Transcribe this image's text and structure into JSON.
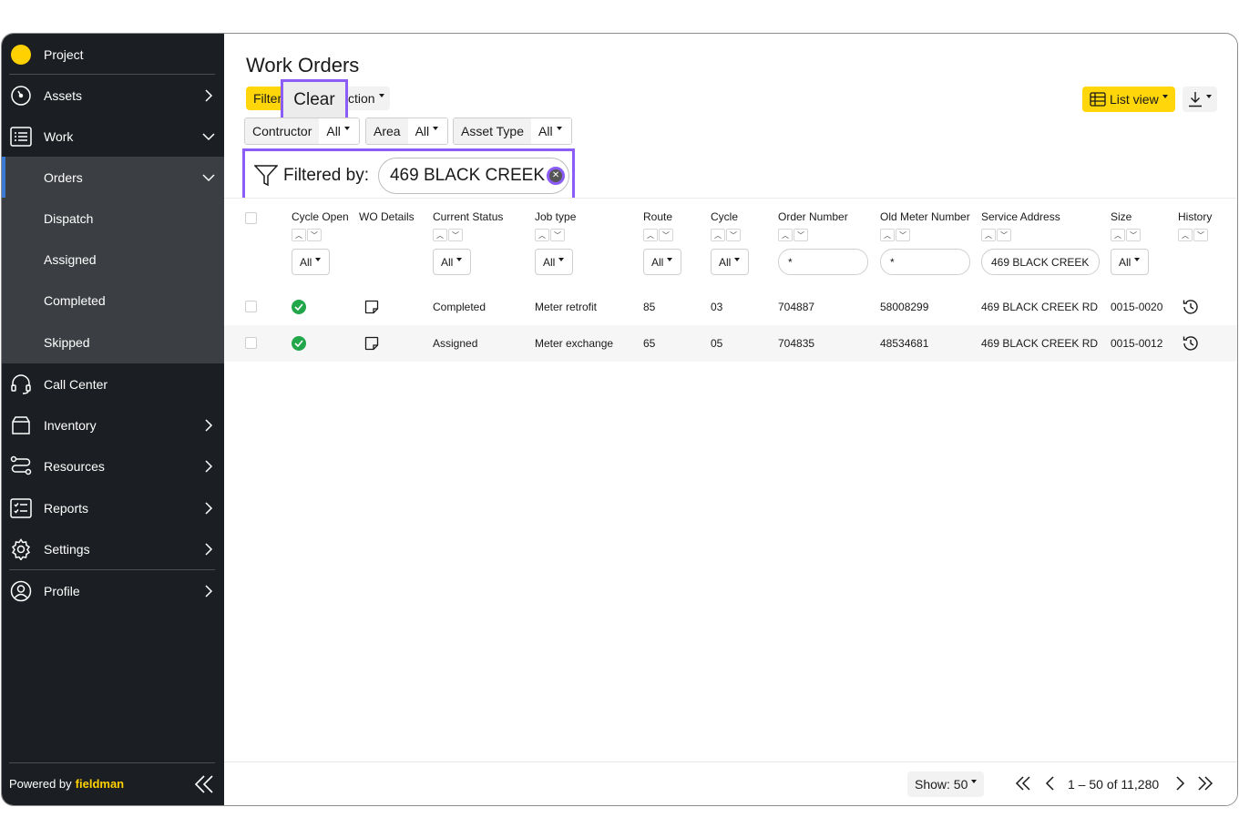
{
  "sidebar": {
    "items": [
      {
        "label": "Project",
        "icon": "project-dot"
      },
      {
        "label": "Assets",
        "icon": "gauge-icon"
      },
      {
        "label": "Work",
        "icon": "list-icon"
      },
      {
        "label": "Orders"
      },
      {
        "label": "Dispatch"
      },
      {
        "label": "Assigned"
      },
      {
        "label": "Completed"
      },
      {
        "label": "Skipped"
      },
      {
        "label": "Call Center",
        "icon": "headset-icon"
      },
      {
        "label": "Inventory",
        "icon": "box-icon"
      },
      {
        "label": "Resources",
        "icon": "route-icon"
      },
      {
        "label": "Reports",
        "icon": "report-icon"
      },
      {
        "label": "Settings",
        "icon": "gear-icon"
      },
      {
        "label": "Profile",
        "icon": "user-icon"
      }
    ],
    "powered_by": "Powered by",
    "brand": "fieldman"
  },
  "header": {
    "title": "Work Orders",
    "filter_label": "Filter",
    "clear_label": "Clear",
    "action_label": "ction",
    "view_label": "List view"
  },
  "filters": {
    "contractor_key": "Contructor",
    "contractor_val": "All",
    "area_key": "Area",
    "area_val": "All",
    "asset_type_key": "Asset Type",
    "asset_type_val": "All",
    "filtered_by_label": "Filtered by:",
    "chip_value": "469 BLACK CREEK"
  },
  "table": {
    "headers": {
      "cycle_open": "Cycle Open",
      "wo_details": "WO Details",
      "current_status": "Current Status",
      "job_type": "Job type",
      "route": "Route",
      "cycle": "Cycle",
      "order_number": "Order Number",
      "old_meter_number": "Old Meter Number",
      "service_address": "Service Address",
      "size": "Size",
      "history": "History"
    },
    "filter_values": {
      "status": "All",
      "job_type": "All",
      "route": "All",
      "cycle": "All",
      "order_number": "*",
      "old_meter_number": "*",
      "service_address": "469 BLACK CREEK",
      "size": "All",
      "cycle_open": "All"
    },
    "rows": [
      {
        "status": "Completed",
        "job_type": "Meter retrofit",
        "route": "85",
        "cycle": "03",
        "order_number": "704887",
        "old_meter": "58008299",
        "address": "469 BLACK CREEK RD",
        "size": "0015-0020"
      },
      {
        "status": "Assigned",
        "job_type": "Meter exchange",
        "route": "65",
        "cycle": "05",
        "order_number": "704835",
        "old_meter": "48534681",
        "address": "469 BLACK CREEK RD",
        "size": "0015-0012"
      }
    ]
  },
  "footer": {
    "show_label": "Show: 50",
    "range_label": "1 – 50 of 11,280"
  },
  "colors": {
    "accent": "#ffd60a",
    "highlight": "#8b5cf6",
    "sidebar_bg": "#1b1e22",
    "success": "#22a64a"
  }
}
